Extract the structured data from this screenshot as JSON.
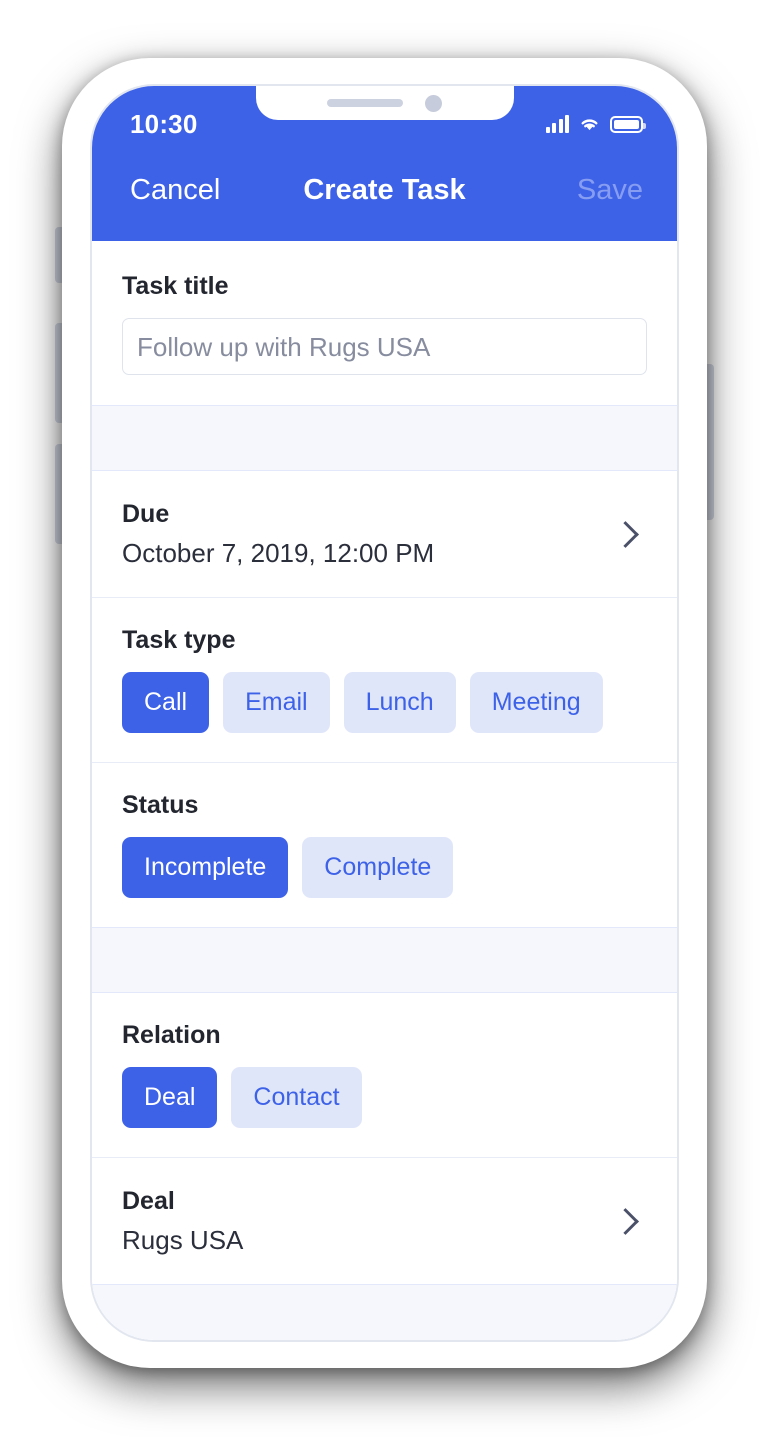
{
  "device": {
    "notch": {
      "speaker": "speaker-grille",
      "camera": "front-camera"
    },
    "buttons": [
      "silent-switch",
      "volume-up",
      "volume-down",
      "power"
    ]
  },
  "status_bar": {
    "time": "10:30",
    "icons": [
      "cellular-signal-icon",
      "wifi-icon",
      "battery-icon"
    ]
  },
  "navbar": {
    "cancel_label": "Cancel",
    "title": "Create Task",
    "save_label": "Save",
    "background_color": "#3d62e8",
    "save_disabled": true
  },
  "form": {
    "task_title": {
      "label": "Task title",
      "value": "",
      "placeholder": "Follow up with Rugs USA"
    },
    "due": {
      "label": "Due",
      "value": "October 7, 2019, 12:00 PM",
      "chevron": "chevron-right-icon"
    },
    "task_type": {
      "label": "Task type",
      "options": [
        {
          "label": "Call",
          "selected": true
        },
        {
          "label": "Email",
          "selected": false
        },
        {
          "label": "Lunch",
          "selected": false
        },
        {
          "label": "Meeting",
          "selected": false
        }
      ]
    },
    "status": {
      "label": "Status",
      "options": [
        {
          "label": "Incomplete",
          "selected": true
        },
        {
          "label": "Complete",
          "selected": false
        }
      ]
    },
    "relation": {
      "label": "Relation",
      "options": [
        {
          "label": "Deal",
          "selected": true
        },
        {
          "label": "Contact",
          "selected": false
        }
      ]
    },
    "deal": {
      "label": "Deal",
      "value": "Rugs USA",
      "chevron": "chevron-right-icon"
    }
  },
  "colors": {
    "accent": "#3d62e8",
    "chip_unselected_bg": "#e0e6fa",
    "chip_unselected_text": "#3d62e8",
    "section_gap_bg": "#f5f7fd",
    "text_primary": "#23262f",
    "placeholder": "#878d9f"
  }
}
